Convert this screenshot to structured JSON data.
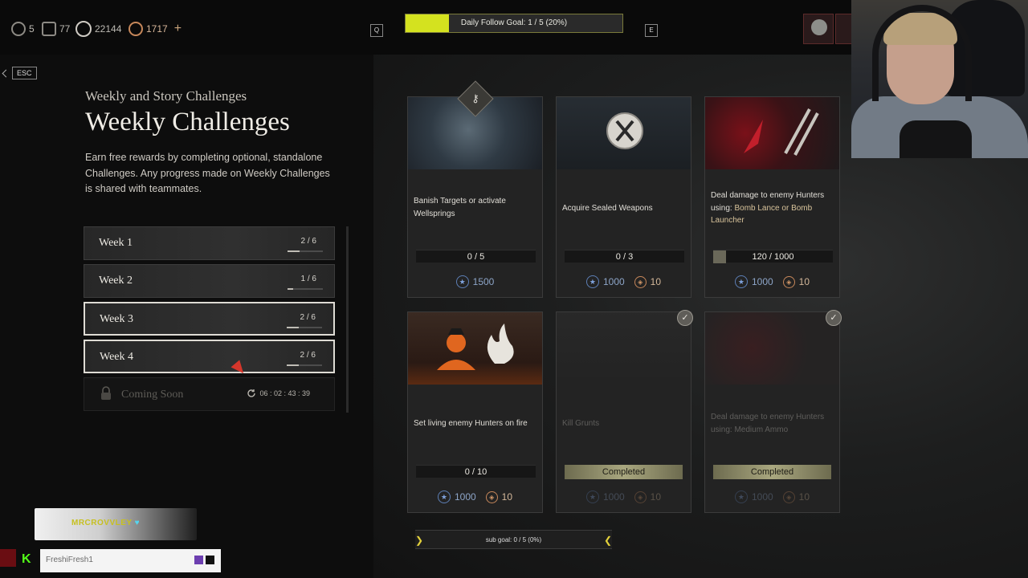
{
  "topbar": {
    "currencies": [
      {
        "icon": "medal-icon",
        "value": "5"
      },
      {
        "icon": "tablet-icon",
        "value": "77"
      },
      {
        "icon": "coin-icon",
        "value": "22144"
      },
      {
        "icon": "token-icon",
        "value": "1717"
      }
    ],
    "plus": "+",
    "key_left": "Q",
    "key_right": "E",
    "follow_goal": {
      "label": "Daily Follow Goal: 1 / 5 (20%)",
      "progress": 0.2,
      "color": "#d4e21f"
    }
  },
  "esc": {
    "key": "ESC"
  },
  "header": {
    "subtitle": "Weekly and Story Challenges",
    "title": "Weekly Challenges",
    "description": "Earn free rewards by completing optional, standalone Challenges. Any progress made on Weekly Challenges is shared with teammates."
  },
  "weeks": [
    {
      "label": "Week 1",
      "count": "2 / 6",
      "progress": 0.33
    },
    {
      "label": "Week 2",
      "count": "1 / 6",
      "progress": 0.17
    },
    {
      "label": "Week 3",
      "count": "2 / 6",
      "progress": 0.33,
      "selected": true
    },
    {
      "label": "Week 4",
      "count": "2 / 6",
      "progress": 0.33
    }
  ],
  "locked_week": {
    "label": "Coming Soon",
    "timer": "06 : 02 : 43 : 39"
  },
  "challenges": [
    {
      "text": "Banish Targets or activate Wellsprings",
      "progress": "0 / 5",
      "xp": "1500"
    },
    {
      "text": "Acquire Sealed Weapons",
      "progress": "0 / 3",
      "xp": "1000",
      "tokens": "10"
    },
    {
      "text": "Deal damage to enemy Hunters using: ",
      "highlight": "Bomb Lance or Bomb Launcher",
      "progress": "120 / 1000",
      "xp": "1000",
      "tokens": "10"
    },
    {
      "text": "Set living enemy Hunters on fire",
      "progress": "0 / 10",
      "xp": "1000",
      "tokens": "10"
    },
    {
      "text": "Kill Grunts",
      "status": "Completed",
      "xp": "1000",
      "tokens": "10"
    },
    {
      "text": "Deal damage to enemy Hunters using: Medium Ammo",
      "status": "Completed",
      "xp": "1000",
      "tokens": "10"
    }
  ],
  "sub_goal": {
    "label": "sub goal: 0 / 5 (0%)"
  },
  "stream_overlay": {
    "alert_prefix": "",
    "alert_name": "MRCROVVLEY",
    "alert_heart": "♥",
    "chat_logo": "K",
    "chat_name": "FreshiFresh1"
  }
}
